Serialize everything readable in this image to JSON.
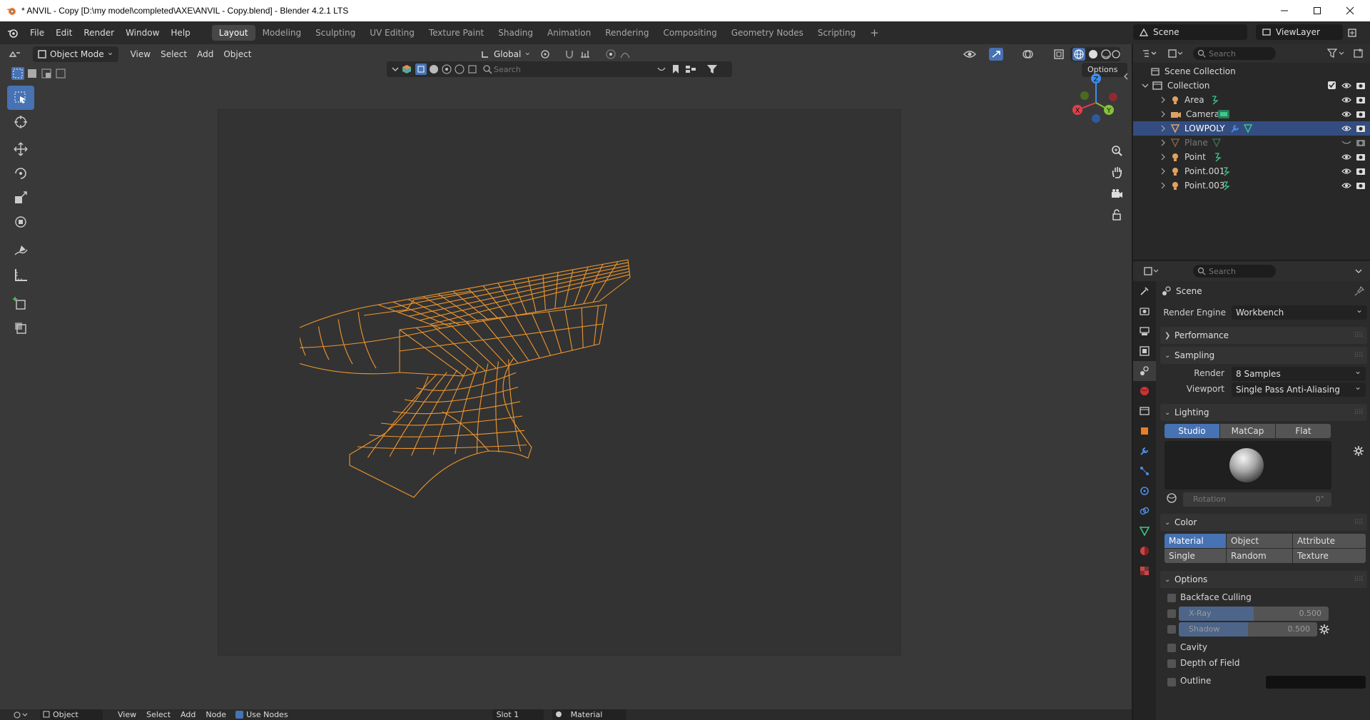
{
  "window": {
    "title": "* ANVIL - Copy [D:\\my model\\completed\\AXE\\ANVIL - Copy.blend] - Blender 4.2.1 LTS",
    "controls": [
      "minimize",
      "maximize",
      "close"
    ]
  },
  "topbar": {
    "menus": [
      "File",
      "Edit",
      "Render",
      "Window",
      "Help"
    ],
    "workspaces": [
      "Layout",
      "Modeling",
      "Sculpting",
      "UV Editing",
      "Texture Paint",
      "Shading",
      "Animation",
      "Rendering",
      "Compositing",
      "Geometry Nodes",
      "Scripting"
    ],
    "active_workspace": "Layout",
    "add_workspace": "+",
    "scene": "Scene",
    "view_layer": "ViewLayer"
  },
  "viewport": {
    "mode": "Object Mode",
    "menus": [
      "View",
      "Select",
      "Add",
      "Object"
    ],
    "transform_orientation": "Global",
    "search_placeholder": "Search",
    "options_label": "Options",
    "gizmo": {
      "x": "X",
      "y": "Y",
      "z": "Z"
    },
    "object_color": "#f0962b"
  },
  "bottom": {
    "editor": "Object",
    "menus": [
      "View",
      "Select",
      "Add",
      "Node"
    ],
    "use_nodes": "Use Nodes",
    "slot": "Slot 1",
    "material": "Material"
  },
  "outliner": {
    "search_placeholder": "Search",
    "root": "Scene Collection",
    "collection": "Collection",
    "items": [
      {
        "label": "Area",
        "icon": "light-icon",
        "selected": false,
        "hidden": false
      },
      {
        "label": "Camera",
        "icon": "camera-icon",
        "selected": false,
        "hidden": false
      },
      {
        "label": "LOWPOLY",
        "icon": "mesh-icon",
        "selected": true,
        "hidden": false
      },
      {
        "label": "Plane",
        "icon": "mesh-icon",
        "selected": false,
        "hidden": true
      },
      {
        "label": "Point",
        "icon": "light-icon",
        "selected": false,
        "hidden": false
      },
      {
        "label": "Point.001",
        "icon": "light-icon",
        "selected": false,
        "hidden": false
      },
      {
        "label": "Point.003",
        "icon": "light-icon",
        "selected": false,
        "hidden": false
      }
    ]
  },
  "properties": {
    "search_placeholder": "Search",
    "context": "Scene",
    "render_engine_label": "Render Engine",
    "render_engine": "Workbench",
    "panels": {
      "performance": "Performance",
      "sampling": "Sampling",
      "lighting": "Lighting",
      "color": "Color",
      "options": "Options"
    },
    "sampling": {
      "render_label": "Render",
      "render_value": "8 Samples",
      "viewport_label": "Viewport",
      "viewport_value": "Single Pass Anti-Aliasing"
    },
    "lighting": {
      "modes": [
        "Studio",
        "MatCap",
        "Flat"
      ],
      "active": "Studio",
      "rotation_label": "Rotation",
      "rotation_value": "0°"
    },
    "color": {
      "options": [
        "Material",
        "Object",
        "Attribute",
        "Single",
        "Random",
        "Texture"
      ],
      "active": "Material"
    },
    "options": {
      "backface_culling": "Backface Culling",
      "xray_label": "X-Ray",
      "xray_value": "0.500",
      "xray_fraction": 0.5,
      "shadow_label": "Shadow",
      "shadow_value": "0.500",
      "shadow_fraction": 0.5,
      "cavity": "Cavity",
      "depth_of_field": "Depth of Field",
      "outline": "Outline"
    }
  }
}
